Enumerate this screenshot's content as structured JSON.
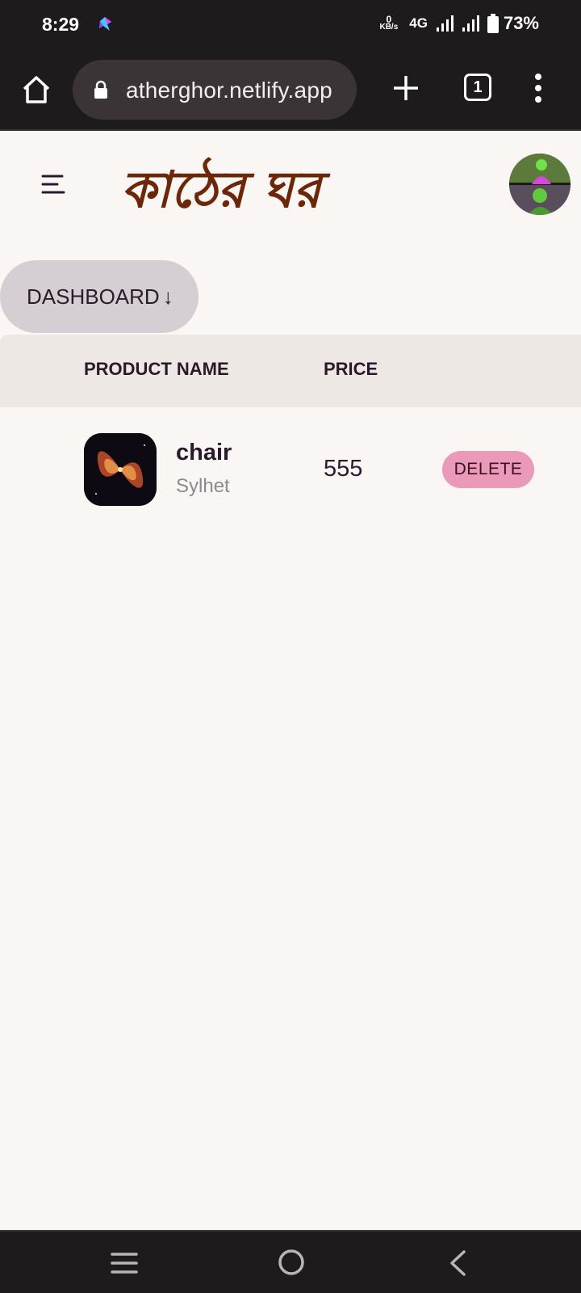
{
  "status_bar": {
    "time": "8:29",
    "net_speed_value": "0",
    "net_speed_unit": "KB/s",
    "network_type": "4G",
    "battery": "73%"
  },
  "browser": {
    "url": "atherghor.netlify.app",
    "tab_count": "1"
  },
  "header": {
    "title": "কাঠের ঘর"
  },
  "dashboard_button": {
    "label": "DASHBOARD",
    "arrow": "↓"
  },
  "table": {
    "columns": [
      "PRODUCT NAME",
      "PRICE"
    ],
    "rows": [
      {
        "name": "chair",
        "location": "Sylhet",
        "price": "555",
        "action": "DELETE"
      }
    ]
  },
  "colors": {
    "brand_title": "#6b2708",
    "delete_button": "#ea9ab8",
    "dashboard_button": "#d5ced3",
    "system_bar": "#1e1b1c"
  },
  "icons": {
    "home": "home-icon",
    "lock": "lock-icon",
    "new_tab": "plus-icon",
    "tabs": "tab-counter-icon",
    "menu": "more-vert-icon",
    "hamburger": "menu-icon",
    "nav_recent": "recent-apps-icon",
    "nav_home": "nav-home-icon",
    "nav_back": "back-icon"
  }
}
